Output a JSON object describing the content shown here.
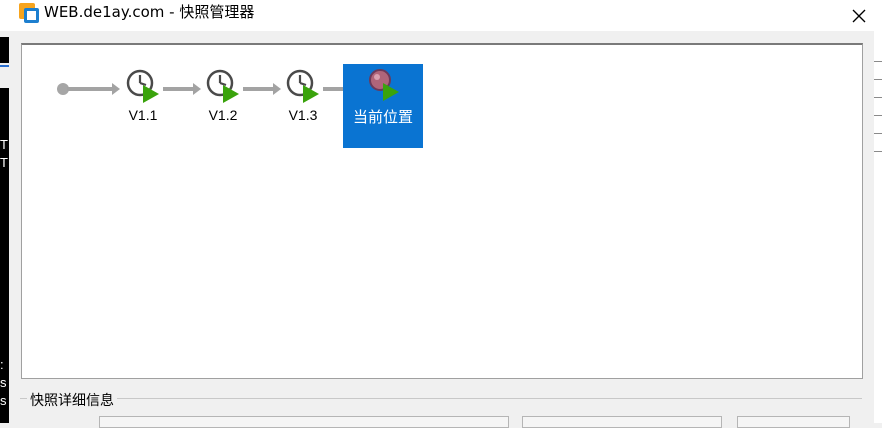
{
  "window": {
    "title": "WEB.de1ay.com - 快照管理器",
    "icon": "vmware-app-icon",
    "close_icon": "close-icon"
  },
  "tree": {
    "snapshots": [
      {
        "label": "V1.1",
        "icon": "snapshot-clock-icon"
      },
      {
        "label": "V1.2",
        "icon": "snapshot-clock-icon"
      },
      {
        "label": "V1.3",
        "icon": "snapshot-clock-icon"
      }
    ],
    "current": {
      "label": "当前位置",
      "icon": "current-state-icon"
    }
  },
  "details": {
    "group_title": "快照详细信息"
  },
  "colors": {
    "selection": "#0a74d2",
    "connector": "#a3a3a3",
    "play_green": "#3aa30c"
  },
  "background_edges": {
    "left_letters": [
      "T",
      "T",
      ":",
      "s",
      "s"
    ]
  }
}
